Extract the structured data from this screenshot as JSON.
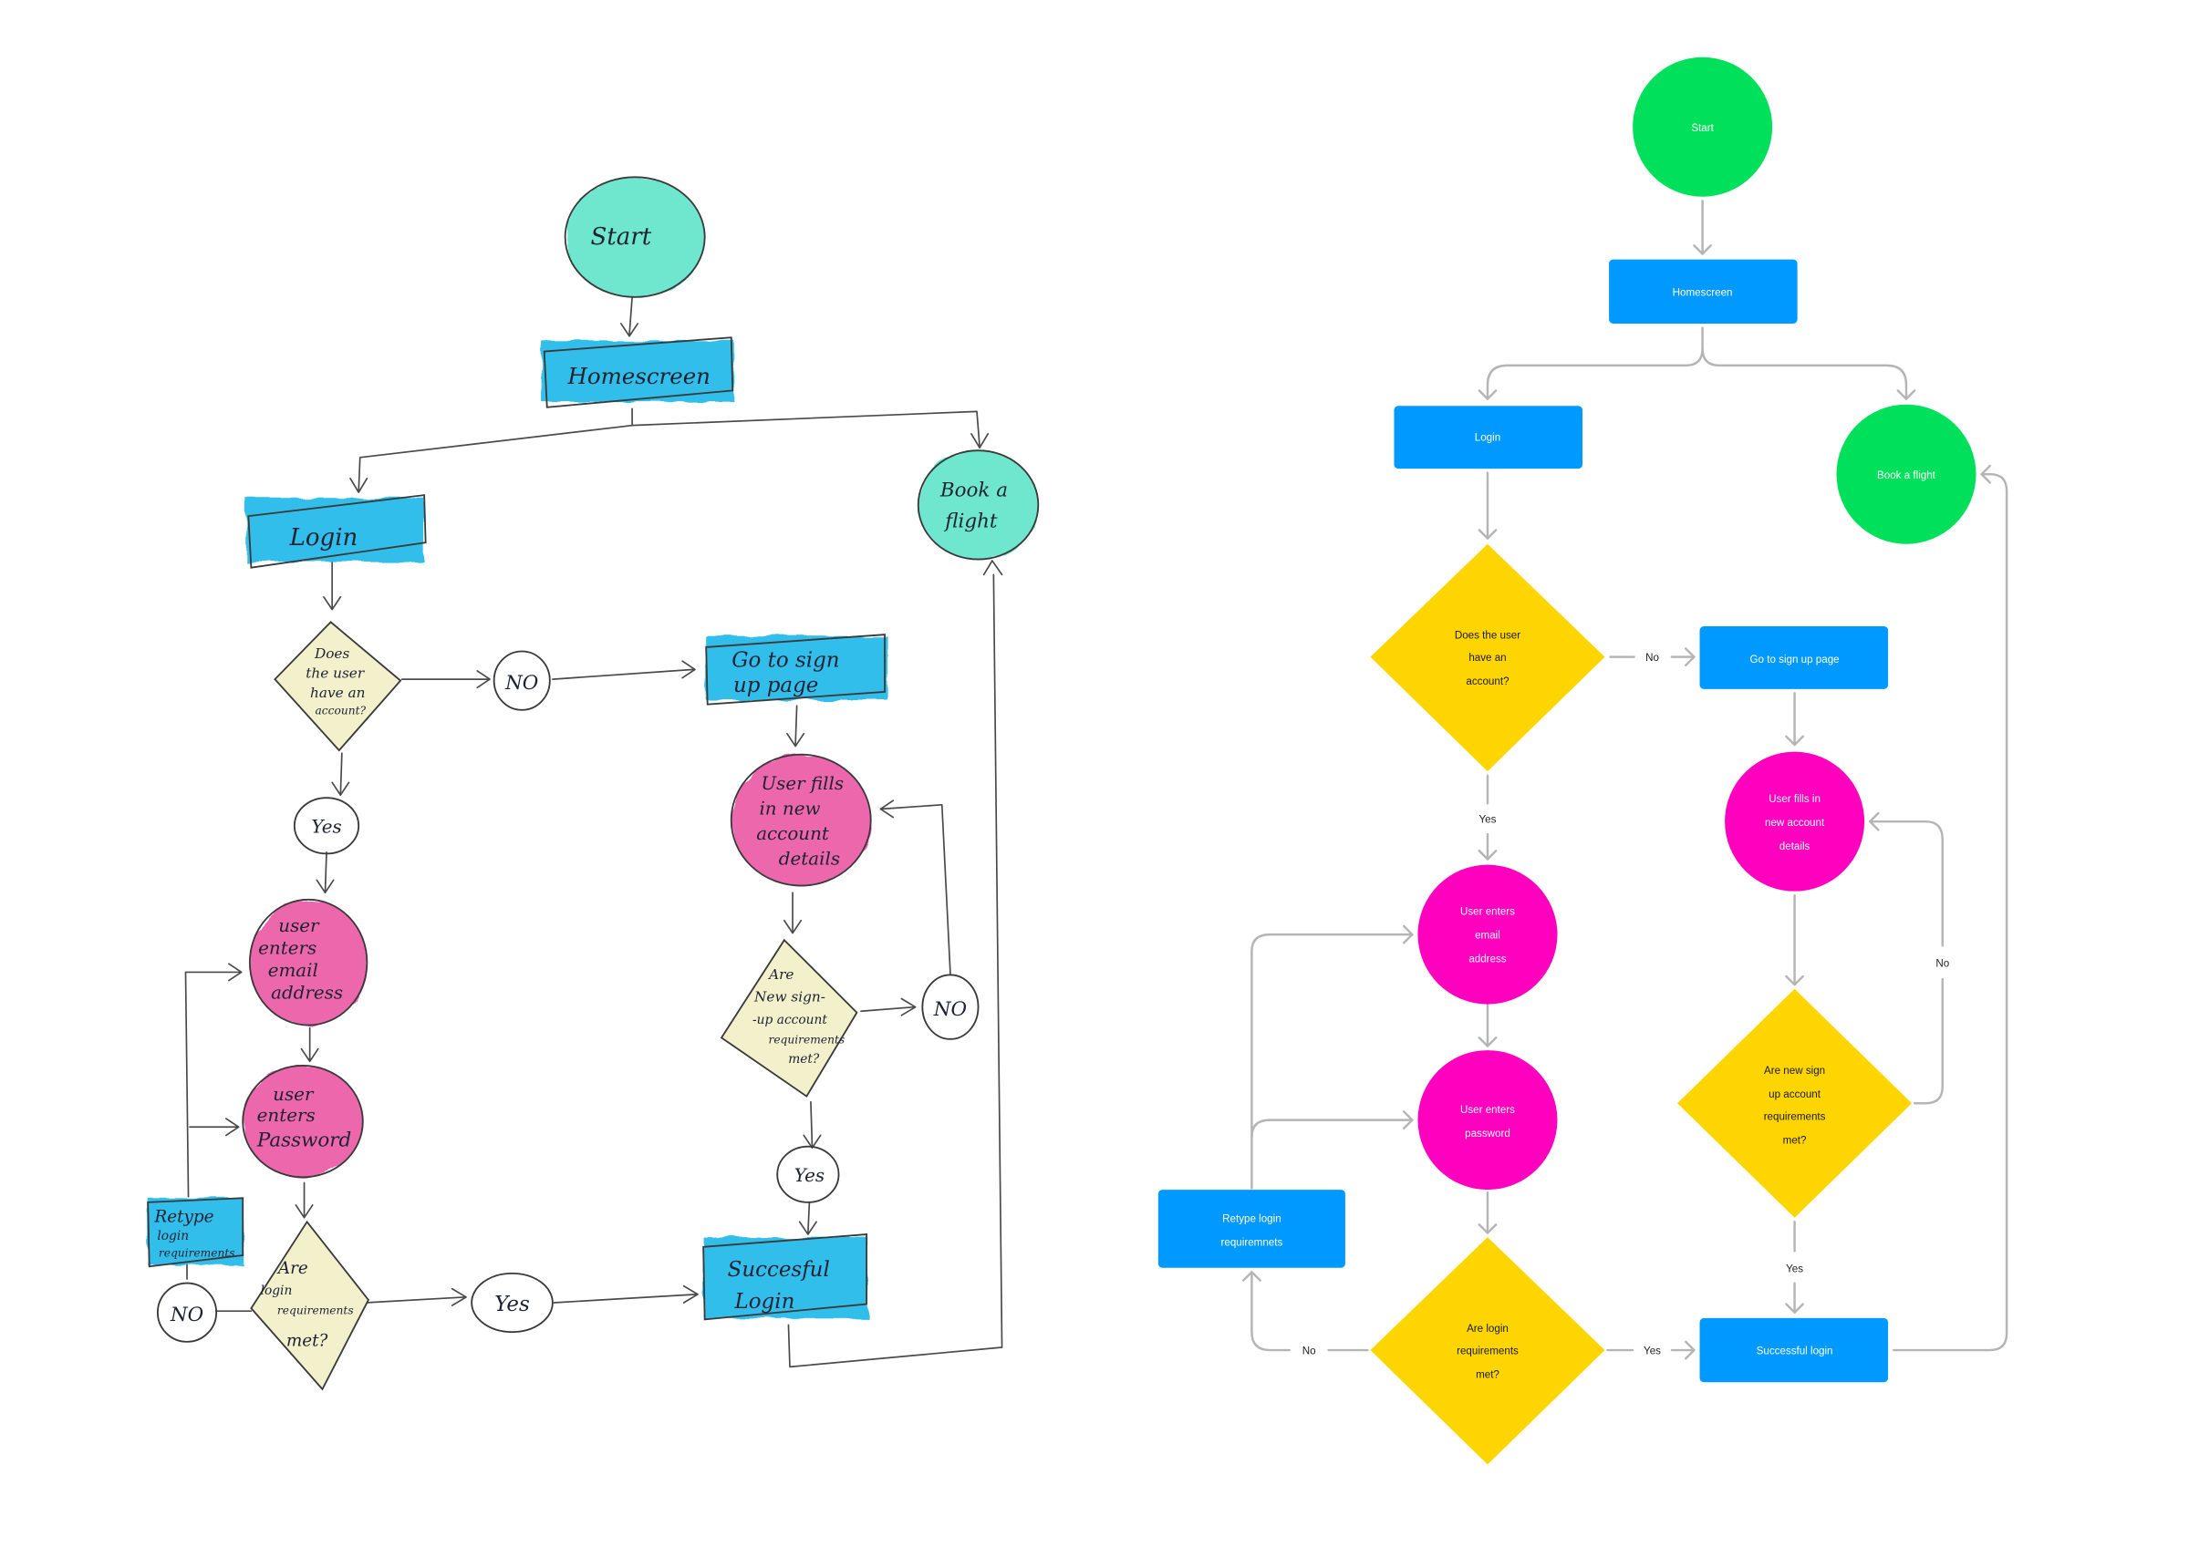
{
  "colors": {
    "sketch_mint": "#55e3c6",
    "sketch_cyan": "#1bb8e8",
    "sketch_magenta": "#ea4d9f",
    "sketch_pale_yellow": "#f2f1cc",
    "digital_green": "#00e05a",
    "digital_blue": "#0099ff",
    "digital_magenta": "#ff00bf",
    "digital_yellow": "#ffd500",
    "connector_gray": "#b5b5b5"
  },
  "sketch": {
    "start": "Start",
    "homescreen": "Homescreen",
    "login": "Login",
    "book_flight": [
      "Book a",
      "flight"
    ],
    "has_account": [
      "Does",
      "the user",
      "have an",
      "account?"
    ],
    "no_1": "NO",
    "yes_1": "Yes",
    "go_signup": [
      "Go to sign",
      "up page"
    ],
    "fills_details": [
      "User fills",
      "in new",
      "account",
      "details"
    ],
    "enters_email": [
      "user",
      "enters",
      "email",
      "address"
    ],
    "enters_password": [
      "user",
      "enters",
      "Password"
    ],
    "signup_req": [
      "Are",
      "New sign-",
      "-up account",
      "requirements",
      "met?"
    ],
    "no_2": "NO",
    "yes_2": "Yes",
    "retype": [
      "Retype",
      "login",
      "requirements"
    ],
    "login_req": [
      "Are",
      "login",
      "requirements",
      "met?"
    ],
    "no_3": "NO",
    "yes_3": "Yes",
    "successful_login": [
      "Succesful",
      "Login"
    ]
  },
  "digital": {
    "start": "Start",
    "homescreen": "Homescreen",
    "login": "Login",
    "book_flight": "Book a flight",
    "has_account": [
      "Does the user",
      "have an",
      "account?"
    ],
    "label_no_1": "No",
    "label_yes_1": "Yes",
    "go_signup": "Go to sign up page",
    "fills_details": [
      "User fills in",
      "new account",
      "details"
    ],
    "enters_email": [
      "User enters",
      "email",
      "address"
    ],
    "enters_password": [
      "User enters",
      "password"
    ],
    "signup_req": [
      "Are new sign",
      "up account",
      "requirements",
      "met?"
    ],
    "label_no_2": "No",
    "label_yes_2": "Yes",
    "retype": [
      "Retype login",
      "requiremnets"
    ],
    "login_req": [
      "Are login",
      "requirements",
      "met?"
    ],
    "label_no_3": "No",
    "label_yes_3": "Yes",
    "successful_login": "Successful login"
  }
}
